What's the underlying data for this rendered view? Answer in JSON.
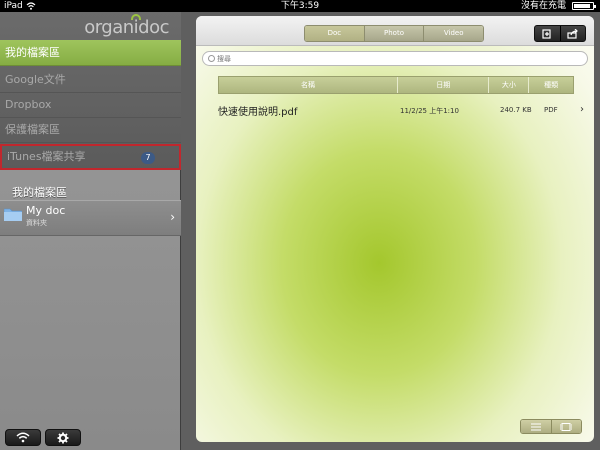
{
  "status_bar": {
    "carrier": "iPad",
    "time": "下午3:59",
    "battery_text": "沒有在充電",
    "battery_level_fraction": 0.8
  },
  "sidebar": {
    "logo": "organidoc",
    "nav": [
      {
        "label": "我的檔案區",
        "active": true
      },
      {
        "label": "Google文件"
      },
      {
        "label": "Dropbox"
      },
      {
        "label": "保護檔案區"
      },
      {
        "label": "iTunes檔案共享",
        "badge": "7"
      }
    ],
    "section_title": "我的檔案區",
    "folder": {
      "name": "My doc",
      "subtitle": "資料夾"
    },
    "bottom_buttons": [
      {
        "icon": "wifi-icon"
      },
      {
        "icon": "gear-icon"
      }
    ]
  },
  "toolbar": {
    "segments": [
      "Doc",
      "Photo",
      "Video"
    ],
    "selected_segment": "Doc",
    "actions": [
      {
        "icon": "import-file-icon"
      },
      {
        "icon": "share-export-icon"
      }
    ]
  },
  "search": {
    "placeholder": "搜尋"
  },
  "table": {
    "headers": [
      "名稱",
      "日期",
      "大小",
      "種類"
    ],
    "rows": [
      {
        "name": "快速使用說明.pdf",
        "date": "11/2/25 上午1:10",
        "size": "240.7 KB",
        "type": "PDF"
      }
    ]
  },
  "view_toggle": [
    {
      "icon": "list-view-icon"
    },
    {
      "icon": "filmstrip-view-icon"
    }
  ],
  "colors": {
    "accent_green": "#93b94e",
    "badge_blue": "#3c5a86",
    "highlight_red": "#c1272d"
  }
}
